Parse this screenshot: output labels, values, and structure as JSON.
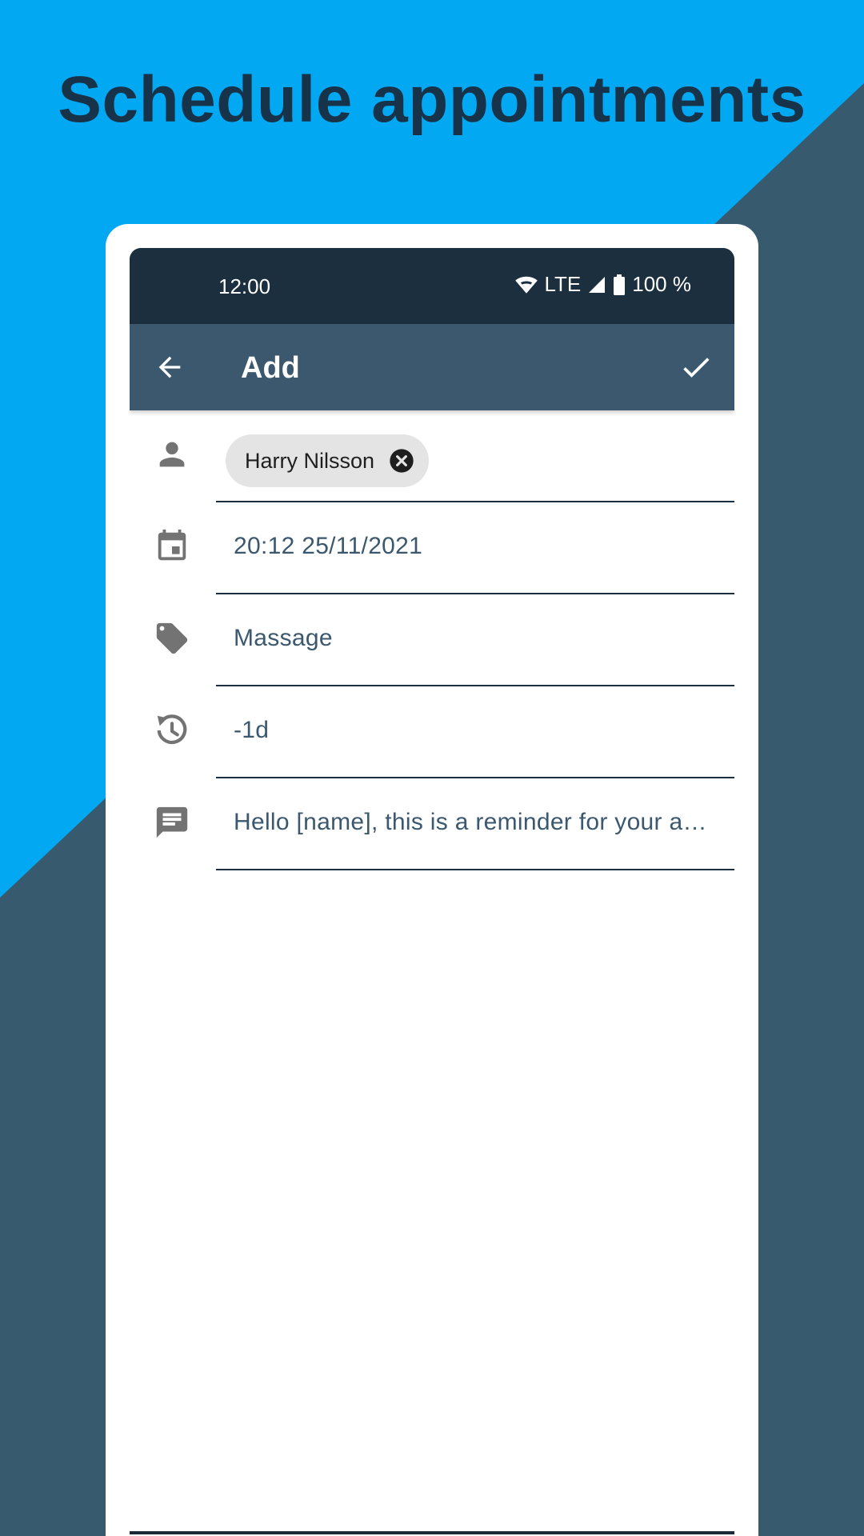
{
  "headline": "Schedule appointments",
  "colors": {
    "background_light": "#03a8f3",
    "background_dark": "#385a6f",
    "headline": "#173349",
    "status_bar": "#1b2f3f",
    "app_bar": "#3b586e",
    "field_text": "#3b586e",
    "chip_bg": "#e4e4e4"
  },
  "status_bar": {
    "time": "12:00",
    "network": "LTE",
    "battery": "100 %",
    "icons": [
      "wifi-icon",
      "signal-icon",
      "battery-icon"
    ]
  },
  "app_bar": {
    "title": "Add",
    "back_icon": "arrow-left-icon",
    "confirm_icon": "checkmark-icon"
  },
  "form": {
    "contact": {
      "icon": "person-icon",
      "chip_label": "Harry Nilsson",
      "chip_remove_icon": "close-circle-icon"
    },
    "datetime": {
      "icon": "calendar-icon",
      "value": "20:12 25/11/2021"
    },
    "service": {
      "icon": "tag-icon",
      "value": "Massage"
    },
    "reminder": {
      "icon": "history-icon",
      "value": "-1d"
    },
    "message": {
      "icon": "message-icon",
      "value": "Hello [name], this is a reminder for your appointment"
    }
  }
}
